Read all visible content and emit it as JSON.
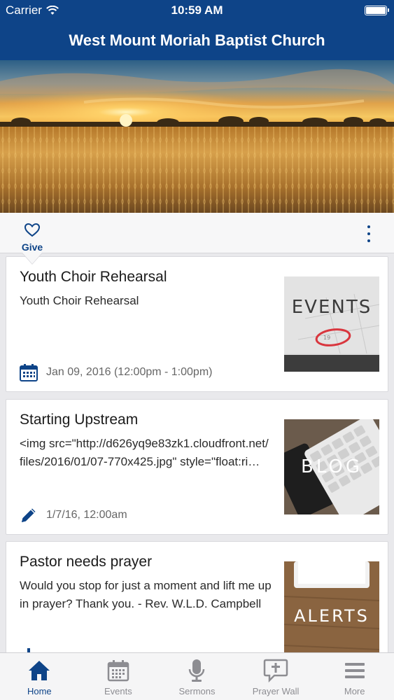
{
  "status": {
    "carrier": "Carrier",
    "time": "10:59 AM",
    "battery_level": 1.0
  },
  "header": {
    "title": "West Mount Moriah Baptist Church"
  },
  "actions": {
    "give_label": "Give"
  },
  "cards": [
    {
      "title": "Youth Choir Rehearsal",
      "description": "Youth Choir Rehearsal",
      "meta": "Jan 09, 2016 (12:00pm - 1:00pm)",
      "meta_icon": "calendar-icon",
      "thumb_text": "EVENTS"
    },
    {
      "title": "Starting Upstream",
      "description": "<img src=\"http://d626yq9e83zk1.cloudfront.net/files/2016/01/07-770x425.jpg\" style=\"float:ri…",
      "meta": "1/7/16, 12:00am",
      "meta_icon": "pencil-icon",
      "thumb_text": "BLOG"
    },
    {
      "title": "Pastor needs prayer",
      "description": "Would you stop for just a moment and lift me up in prayer?  Thank you.  - Rev. W.L.D. Campbell",
      "meta": "",
      "meta_icon": "prayer-icon",
      "thumb_text": "ALERTS"
    }
  ],
  "tabs": [
    {
      "label": "Home",
      "icon": "home-icon",
      "active": true
    },
    {
      "label": "Events",
      "icon": "calendar-icon",
      "active": false
    },
    {
      "label": "Sermons",
      "icon": "microphone-icon",
      "active": false
    },
    {
      "label": "Prayer Wall",
      "icon": "prayer-bubble-icon",
      "active": false
    },
    {
      "label": "More",
      "icon": "menu-icon",
      "active": false
    }
  ],
  "colors": {
    "brand": "#0e4488",
    "tab_inactive": "#8d8d92"
  }
}
